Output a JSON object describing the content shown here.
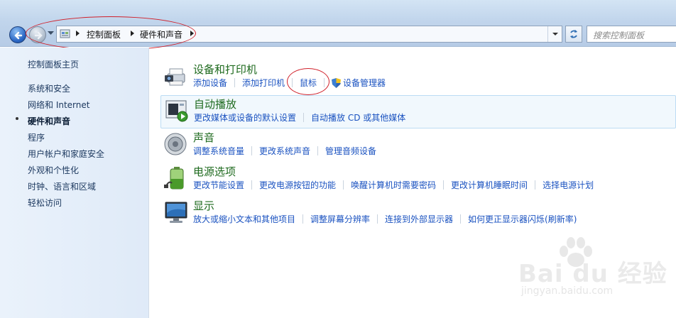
{
  "address_bar": {
    "breadcrumbs": [
      "控制面板",
      "硬件和声音"
    ],
    "search_placeholder": "搜索控制面板"
  },
  "sidebar": {
    "items": [
      {
        "label": "控制面板主页",
        "active": false
      },
      {
        "label": "系统和安全",
        "active": false
      },
      {
        "label": "网络和 Internet",
        "active": false
      },
      {
        "label": "硬件和声音",
        "active": true
      },
      {
        "label": "程序",
        "active": false
      },
      {
        "label": "用户帐户和家庭安全",
        "active": false
      },
      {
        "label": "外观和个性化",
        "active": false
      },
      {
        "label": "时钟、语言和区域",
        "active": false
      },
      {
        "label": "轻松访问",
        "active": false
      }
    ]
  },
  "sections": [
    {
      "title": "设备和打印机",
      "icon": "printer-camera-icon",
      "links": [
        "添加设备",
        "添加打印机",
        "鼠标",
        "设备管理器"
      ]
    },
    {
      "title": "自动播放",
      "icon": "autoplay-icon",
      "links": [
        "更改媒体或设备的默认设置",
        "自动播放 CD 或其他媒体"
      ]
    },
    {
      "title": "声音",
      "icon": "speaker-icon",
      "links": [
        "调整系统音量",
        "更改系统声音",
        "管理音频设备"
      ]
    },
    {
      "title": "电源选项",
      "icon": "battery-icon",
      "links": [
        "更改节能设置",
        "更改电源按钮的功能",
        "唤醒计算机时需要密码",
        "更改计算机睡眠时间",
        "选择电源计划"
      ]
    },
    {
      "title": "显示",
      "icon": "monitor-icon",
      "links": [
        "放大或缩小文本和其他项目",
        "调整屏幕分辨率",
        "连接到外部显示器",
        "如何更正显示器闪烁(刷新率)"
      ]
    }
  ],
  "watermark": {
    "logo": "Bai du 经验",
    "url": "jingyan.baidu.com"
  },
  "colors": {
    "link": "#1a52c0",
    "title": "#1e6a1e",
    "annotation": "#d0202a"
  }
}
